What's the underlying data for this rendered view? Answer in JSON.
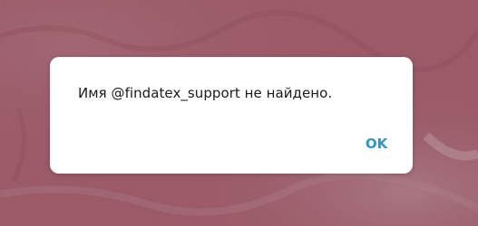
{
  "dialog": {
    "message": "Имя @findatex_support не найдено.",
    "ok_label": "OK"
  },
  "colors": {
    "accent": "#2e93d1",
    "backdrop": "#9b5a68",
    "dialog_bg": "#ffffff"
  }
}
